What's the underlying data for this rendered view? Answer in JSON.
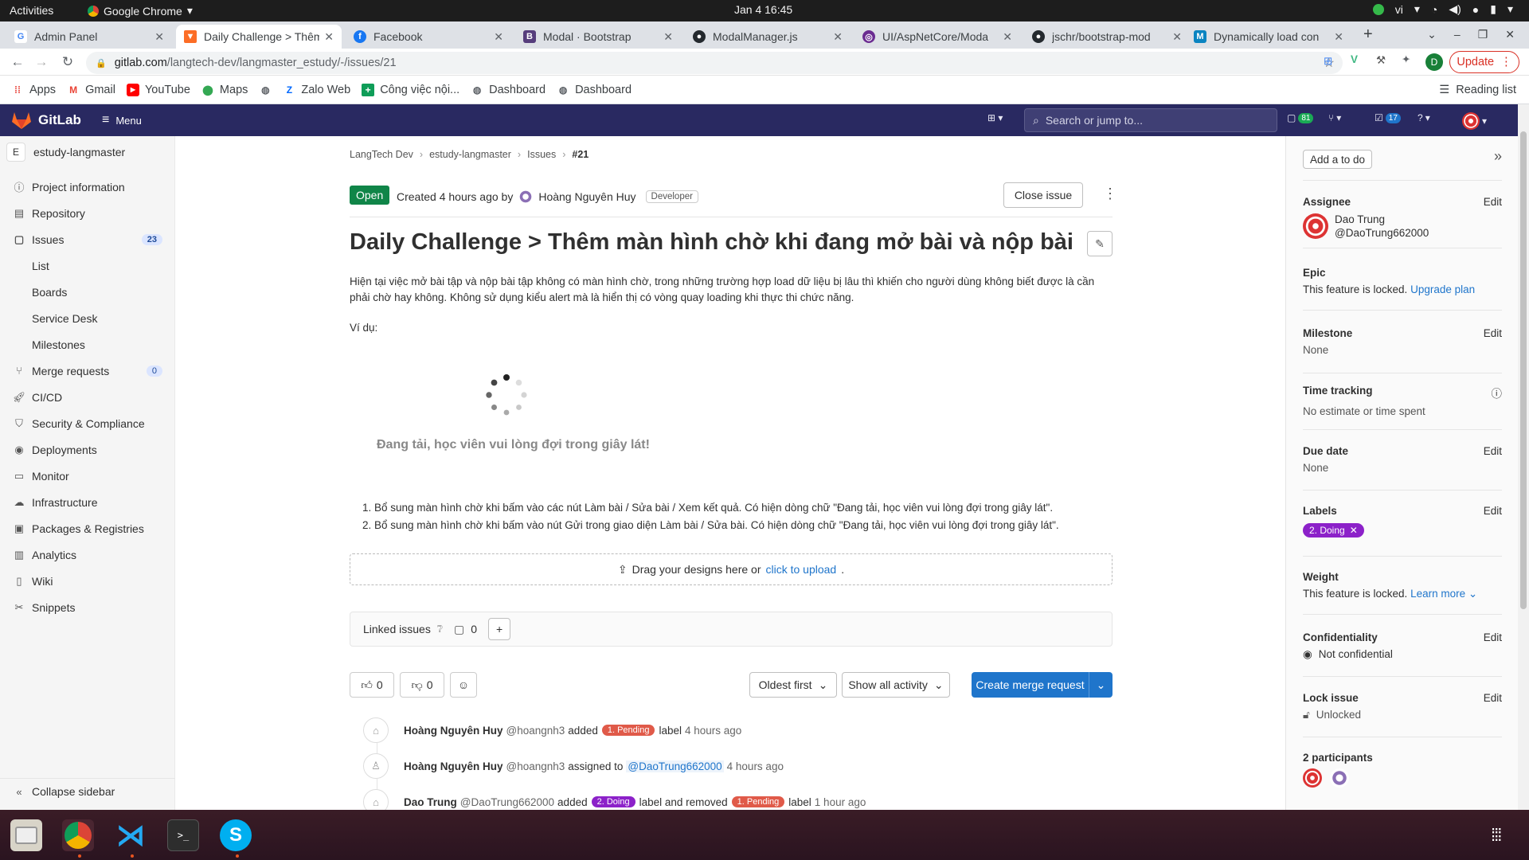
{
  "os": {
    "activities": "Activities",
    "app_name": "Google Chrome",
    "clock": "Jan 4  16:45",
    "lang": "vi"
  },
  "tabs": [
    {
      "title": "Admin Panel"
    },
    {
      "title": "Daily Challenge > Thêm"
    },
    {
      "title": "Facebook"
    },
    {
      "title": "Modal · Bootstrap"
    },
    {
      "title": "ModalManager.js"
    },
    {
      "title": "UI/AspNetCore/Moda"
    },
    {
      "title": "jschr/bootstrap-mod"
    },
    {
      "title": "Dynamically load con"
    }
  ],
  "address": {
    "host": "gitlab.com",
    "path": "/langtech-dev/langmaster_estudy/-/issues/21",
    "update_label": "Update",
    "profile_initial": "D"
  },
  "bookmarks": [
    "Apps",
    "Gmail",
    "YouTube",
    "Maps",
    "Zalo Web",
    "Công việc nội...",
    "Dashboard",
    "Dashboard"
  ],
  "reading_list": "Reading list",
  "gitlab": {
    "brand": "GitLab",
    "menu": "Menu",
    "search_placeholder": "Search or jump to...",
    "issues_count": "81",
    "todos_count": "17"
  },
  "sidebar": {
    "project_initial": "E",
    "project_name": "estudy-langmaster",
    "items": [
      {
        "label": "Project information"
      },
      {
        "label": "Repository"
      },
      {
        "label": "Issues",
        "count": "23"
      },
      {
        "label": "List"
      },
      {
        "label": "Boards"
      },
      {
        "label": "Service Desk"
      },
      {
        "label": "Milestones"
      },
      {
        "label": "Merge requests",
        "count": "0"
      },
      {
        "label": "CI/CD"
      },
      {
        "label": "Security & Compliance"
      },
      {
        "label": "Deployments"
      },
      {
        "label": "Monitor"
      },
      {
        "label": "Infrastructure"
      },
      {
        "label": "Packages & Registries"
      },
      {
        "label": "Analytics"
      },
      {
        "label": "Wiki"
      },
      {
        "label": "Snippets"
      }
    ],
    "collapse": "Collapse sidebar"
  },
  "issue": {
    "breadcrumbs": [
      "LangTech Dev",
      "estudy-langmaster",
      "Issues",
      "#21"
    ],
    "status": "Open",
    "created_prefix": "Created 4 hours ago by",
    "author": "Hoàng Nguyên Huy",
    "role": "Developer",
    "close_label": "Close issue",
    "title": "Daily Challenge > Thêm màn hình chờ khi đang mở bài và nộp bài",
    "description": "Hiện tại việc mở bài tập và nộp bài tập không có màn hình chờ, trong những trường hợp load dữ liệu bị lâu thì khiến cho người dùng không biết được là cần phải chờ hay không. Không sử dụng kiểu alert mà là hiển thị có vòng quay loading khi thực thi chức năng.",
    "example_label": "Ví dụ:",
    "loading_text": "Đang tải, học viên vui lòng đợi trong giây lát!",
    "list": [
      "Bổ sung màn hình chờ khi bấm vào các nút Làm bài / Sửa bài / Xem kết quả. Có hiện dòng chữ \"Đang tải, học viên vui lòng đợi trong giây lát\".",
      "Bổ sung màn hình chờ khi bấm vào nút Gửi trong giao diện Làm bài / Sửa bài. Có hiện dòng chữ \"Đang tải, học viên vui lòng đợi trong giây lát\"."
    ],
    "dropzone_text": "Drag your designs here or",
    "dropzone_link": "click to upload",
    "linked_issues": "Linked issues",
    "linked_count": "0",
    "thumbs_up": "0",
    "thumbs_down": "0",
    "sort": "Oldest first",
    "filter": "Show all activity",
    "create_mr": "Create merge request"
  },
  "activity": [
    {
      "author": "Hoàng Nguyên Huy",
      "handle": "@hoangnh3",
      "pre": "added",
      "label1": "1. Pending",
      "mid": "label",
      "time": "4 hours ago"
    },
    {
      "author": "Hoàng Nguyên Huy",
      "handle": "@hoangnh3",
      "pre": "assigned to",
      "assignee": "@DaoTrung662000",
      "time": "4 hours ago"
    },
    {
      "author": "Dao Trung",
      "handle": "@DaoTrung662000",
      "pre": "added",
      "label1": "2. Doing",
      "mid": "label and removed",
      "label2": "1. Pending",
      "post": "label",
      "time": "1 hour ago"
    }
  ],
  "right_sidebar": {
    "add_todo": "Add a to do",
    "edit": "Edit",
    "assignee_label": "Assignee",
    "assignee_name": "Dao Trung",
    "assignee_handle": "@DaoTrung662000",
    "epic_label": "Epic",
    "epic_text": "This feature is locked.",
    "epic_link": "Upgrade plan",
    "milestone_label": "Milestone",
    "milestone_value": "None",
    "time_label": "Time tracking",
    "time_value": "No estimate or time spent",
    "due_label": "Due date",
    "due_value": "None",
    "labels_label": "Labels",
    "label_chip": "2. Doing",
    "weight_label": "Weight",
    "weight_text": "This feature is locked.",
    "weight_link": "Learn more",
    "conf_label": "Confidentiality",
    "conf_value": "Not confidential",
    "lock_label": "Lock issue",
    "lock_value": "Unlocked",
    "participants": "2 participants"
  },
  "colors": {
    "gitlab_nav": "#292961",
    "open_green": "#108548",
    "primary_blue": "#1f75cb",
    "pending_red": "#e05a49",
    "doing_purple": "#8c21c9"
  }
}
